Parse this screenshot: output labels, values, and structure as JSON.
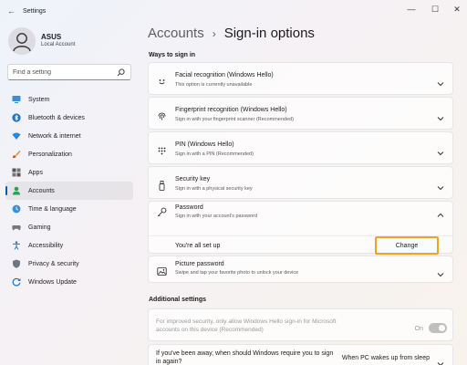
{
  "window": {
    "title": "Settings"
  },
  "profile": {
    "name": "ASUS",
    "account_type": "Local Account"
  },
  "search": {
    "placeholder": "Find a setting"
  },
  "sidebar": {
    "items": [
      {
        "label": "System",
        "icon": "monitor-icon"
      },
      {
        "label": "Bluetooth & devices",
        "icon": "bluetooth-icon"
      },
      {
        "label": "Network & internet",
        "icon": "wifi-icon"
      },
      {
        "label": "Personalization",
        "icon": "brush-icon"
      },
      {
        "label": "Apps",
        "icon": "apps-icon"
      },
      {
        "label": "Accounts",
        "icon": "person-icon",
        "active": true
      },
      {
        "label": "Time & language",
        "icon": "globe-clock-icon"
      },
      {
        "label": "Gaming",
        "icon": "gamepad-icon"
      },
      {
        "label": "Accessibility",
        "icon": "accessibility-icon"
      },
      {
        "label": "Privacy & security",
        "icon": "shield-icon"
      },
      {
        "label": "Windows Update",
        "icon": "update-icon"
      }
    ]
  },
  "breadcrumb": {
    "parent": "Accounts",
    "separator": "›",
    "current": "Sign-in options"
  },
  "ways": {
    "title": "Ways to sign in",
    "cards": [
      {
        "title": "Facial recognition (Windows Hello)",
        "subtitle": "This option is currently unavailable"
      },
      {
        "title": "Fingerprint recognition (Windows Hello)",
        "subtitle": "Sign in with your fingerprint scanner (Recommended)"
      },
      {
        "title": "PIN (Windows Hello)",
        "subtitle": "Sign in with a PIN (Recommended)"
      },
      {
        "title": "Security key",
        "subtitle": "Sign in with a physical security key"
      },
      {
        "title": "Password",
        "subtitle": "Sign in with your account's password",
        "status": "You're all set up",
        "button": "Change"
      },
      {
        "title": "Picture password",
        "subtitle": "Swipe and tap your favorite photo to unlock your device"
      }
    ]
  },
  "additional": {
    "title": "Additional settings",
    "hello_only": {
      "text": "For improved security, only allow Windows Hello sign-in for Microsoft accounts on this device (Recommended)",
      "toggle_label": "On"
    },
    "require_signin": {
      "text": "If you've been away, when should Windows require you to sign in again?",
      "value": "When PC wakes up from sleep"
    }
  },
  "colors": {
    "accent": "#005fb8",
    "focus_outline": "#f0a224"
  }
}
